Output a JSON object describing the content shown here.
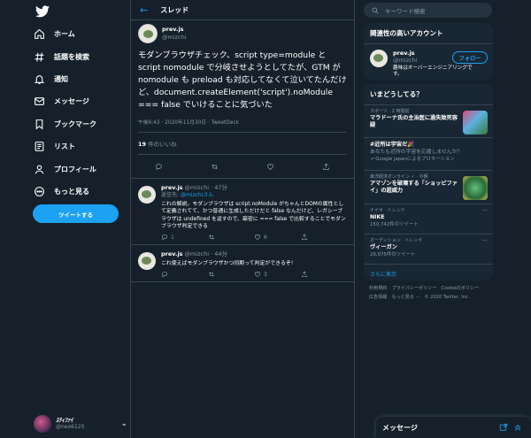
{
  "nav": {
    "items": [
      {
        "label": "ホーム",
        "icon": "home-icon"
      },
      {
        "label": "話題を検索",
        "icon": "hashtag-icon"
      },
      {
        "label": "通知",
        "icon": "bell-icon"
      },
      {
        "label": "メッセージ",
        "icon": "mail-icon"
      },
      {
        "label": "ブックマーク",
        "icon": "bookmark-icon"
      },
      {
        "label": "リスト",
        "icon": "list-icon"
      },
      {
        "label": "プロフィール",
        "icon": "person-icon"
      },
      {
        "label": "もっと見る",
        "icon": "more-circle-icon"
      }
    ],
    "tweet_button": "ツイートする"
  },
  "account": {
    "name": "ｽﾃｨﾌｧｲ",
    "handle": "@neo6120"
  },
  "header": {
    "title": "スレッド"
  },
  "tweet": {
    "name": "prev.js",
    "handle": "@mizchi",
    "text": "モダンブラウザチェック、script type=module と script nomodule で分岐させようとしてたが、GTM が nomodule も preload も対応してなくて泣いてたんだけど、document.createElement('script').noModule === false でいけることに気づいた",
    "time": "午後6:43 · 2020年11月30日 · TweetDeck",
    "likes_count": "19",
    "likes_label": " 件のいいね"
  },
  "replies": [
    {
      "name": "prev.js",
      "handle": "@mizchi · 47分",
      "reply_to_prefix": "返信先: ",
      "reply_to": "@mizchiさん",
      "text": "これの解説。モダンブラウザは script.noModule がちゃんとDOMの属性として定義されてて、かつ普通に生成しただけだと false なんだけど、レガシーブラウザは undefined を返すので、厳密に === false で比較することでモダンブラウザ判定できる",
      "reply_count": "1",
      "like_count": "6"
    },
    {
      "name": "prev.js",
      "handle": "@mizchi · 44分",
      "text": "これ使えばモダンブラウザかつ同期って判定ができるぞ！",
      "like_count": "3"
    }
  ],
  "search": {
    "placeholder": "キーワード検索"
  },
  "recommend": {
    "title": "関連性の高いアカウント",
    "name": "prev.js",
    "handle": "@mizchi",
    "bio": "趣味はオーバーエンジニアリングです。",
    "follow": "フォロー"
  },
  "trends": {
    "title": "いまどうしてる？",
    "items": [
      {
        "category": "スポーツ · 2 時間前",
        "title": "マラドーナ氏の主治医に過失致死容疑"
      },
      {
        "category": "",
        "title": "#近所は宇宙だ🎉",
        "sub": "あなたも近所の宇宙を応援しませんか？",
        "promo": "Google Japanによるプロモーション"
      },
      {
        "category": "東洋経済オンライン ✓ · 今朝",
        "title": "アマゾンを破壊する「ショッピファイ」の超威力"
      },
      {
        "category": "ナイキ · トレンド",
        "title": "NIKE",
        "count": "150,742件のツイート"
      },
      {
        "category": "オーディション · トレンド",
        "title": "ヴィーガン",
        "count": "29,975件のツイート"
      }
    ],
    "more": "さらに表示"
  },
  "footer": {
    "line1": "利用規約　プライバシーポリシー　Cookieのポリシー",
    "line2": "広告情報　もっと見る ···　© 2020 Twitter, Inc."
  },
  "messages": {
    "title": "メッセージ"
  },
  "colors": {
    "accent": "#1da1f2",
    "bg": "#15202b",
    "panel": "#192734",
    "border": "#38444d",
    "muted": "#8899a6"
  }
}
